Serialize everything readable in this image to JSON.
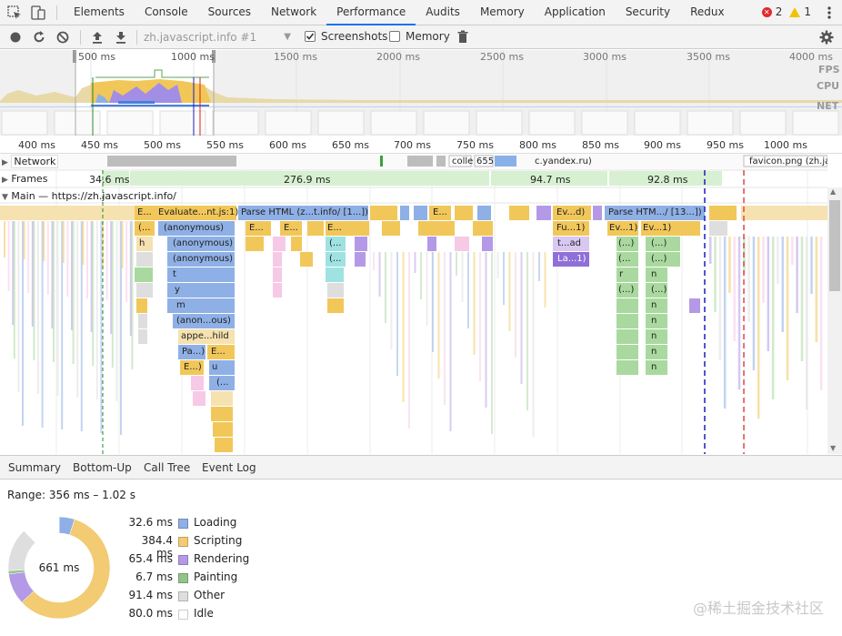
{
  "tabs": [
    "Elements",
    "Console",
    "Sources",
    "Network",
    "Performance",
    "Audits",
    "Memory",
    "Application",
    "Security",
    "Redux"
  ],
  "active_tab": "Performance",
  "errors": {
    "error_count": "2",
    "warning_count": "1"
  },
  "toolbar": {
    "recording_select": "zh.javascript.info #1",
    "screenshots_label": "Screenshots",
    "memory_label": "Memory",
    "screenshots_checked": true,
    "memory_checked": false
  },
  "overview": {
    "ticks": [
      "500 ms",
      "1000 ms",
      "1500 ms",
      "2000 ms",
      "2500 ms",
      "3000 ms",
      "3500 ms",
      "4000 ms"
    ],
    "fps_label": "FPS",
    "cpu_label": "CPU",
    "net_label": "NET"
  },
  "ruler": {
    "ticks": [
      "400 ms",
      "450 ms",
      "500 ms",
      "550 ms",
      "600 ms",
      "650 ms",
      "700 ms",
      "750 ms",
      "800 ms",
      "850 ms",
      "900 ms",
      "950 ms",
      "1000 ms"
    ]
  },
  "tracks": {
    "network_label": "Network",
    "frames_label": "Frames",
    "main_label": "Main — https://zh.javascript.info/",
    "network_items": [
      "colle",
      "655",
      "c.yandex.ru)",
      "favicon.png (zh.ja"
    ],
    "frame_items": [
      "34.6 ms",
      "276.9 ms",
      "94.7 ms",
      "92.8 ms"
    ],
    "main_tasks": [
      "E...",
      "Evaluate...nt.js:1)",
      "Parse HTML (z...t.info/ [1...])",
      "E...",
      "Ev...d)",
      "Parse HTM.../ [13...])"
    ],
    "row1": [
      "(...",
      "(anonymous)",
      "E...",
      "E...",
      "E...",
      "Fu...1)",
      "Ev...1)",
      "Ev...1)"
    ],
    "row2": [
      "h",
      "(anonymous)",
      "(...",
      "t...ad",
      "(...)",
      "(...)"
    ],
    "row3": [
      "(anonymous)",
      "(...",
      "La...1)",
      "(...",
      "(...)"
    ],
    "row4": [
      "t",
      "r",
      "n"
    ],
    "row5": [
      "y",
      "(...)",
      "(...)"
    ],
    "row6": [
      "m",
      "n"
    ],
    "row7": [
      "(anon...ous)",
      "n"
    ],
    "row8": [
      "appe...hild",
      "n"
    ],
    "row9": [
      "Pa...)",
      "E...",
      "n"
    ],
    "row10": [
      "E...)",
      "u",
      "n"
    ],
    "row11": [
      "(..."
    ]
  },
  "bottom_tabs": [
    "Summary",
    "Bottom-Up",
    "Call Tree",
    "Event Log"
  ],
  "summary": {
    "range": "Range: 356 ms – 1.02 s",
    "total": "661 ms",
    "items": [
      {
        "value": "32.6 ms",
        "name": "Loading",
        "color": "#8fb0e6"
      },
      {
        "value": "384.4 ms",
        "name": "Scripting",
        "color": "#f2cb72"
      },
      {
        "value": "65.4 ms",
        "name": "Rendering",
        "color": "#b49ae6"
      },
      {
        "value": "6.7 ms",
        "name": "Painting",
        "color": "#92c48a"
      },
      {
        "value": "91.4 ms",
        "name": "Other",
        "color": "#dedede"
      },
      {
        "value": "80.0 ms",
        "name": "Idle",
        "color": "#ffffff"
      }
    ]
  },
  "watermark": "@稀土掘金技术社区"
}
